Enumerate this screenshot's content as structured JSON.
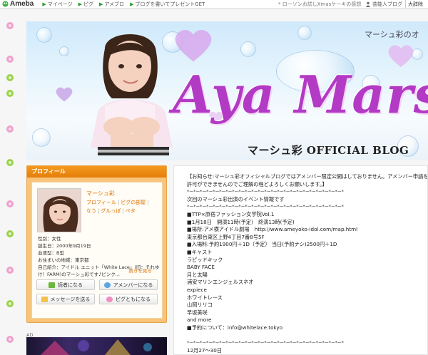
{
  "topbar": {
    "logo": "Ameba",
    "nav": [
      "マイページ",
      "ピグ",
      "アメブロ",
      "ブログを書いてプレゼントGET"
    ],
    "news": "* ローソンお試しXmasケーキの感想",
    "register": "芸能人ブログ",
    "lang": "大辞除"
  },
  "banner": {
    "subtitle": "マーシュ彩のオ",
    "title": "Aya Marsh",
    "blog_label": "マーシュ彩  OFFICIAL BLOG"
  },
  "profile": {
    "header": "プロフィール",
    "name": "マーシュ彩",
    "links": [
      "プロフィール",
      "ピグの部屋",
      "なう",
      "グルっぽ",
      "ペタ"
    ],
    "facts": [
      "性別：女性",
      "誕生日：2000年9月19日",
      "血液型：B型",
      "お住まいの地域：東京都",
      "自己紹介：アイドル ユニット「White Lace」(旧：それゆ",
      "け！FARM)のマーシュ彩です♪ピンク..."
    ],
    "more": "続きを見る",
    "buttons": {
      "reader": "読者になる",
      "member": "アメンバーになる",
      "message": "メッセージを送る",
      "pigg": "ピグともになる"
    }
  },
  "ad": {
    "label": "AD"
  },
  "article": {
    "lines": [
      "【お知らせ:マーシュ彩オフィシャルブログではアメンバー限定公開はしておりません。アメンバー申請を",
      "許可ができませんのでご理解の程どよろしくお願いします。】",
      "*−*−*−*−*−*−*−*−*−*−*−*−*−*−*−*−*−*−*−*−*−*−*−*−*",
      "次回のマーシュ彩出演のイベント情報です",
      "*−*−*−*−*−*−*−*−*−*−*−*−*−*−*−*−*−*−*−*−*−*−*−*−*",
      "■TTP×原宿ファッション女学院Vol.1",
      "■1月18日　開演11時(予定)　終演13時(予定)",
      "■場所:アメ横アイドル劇場　http://www.ameyoko-idol.com/map.html",
      "東京都台東区上野4丁目7番8号5F",
      "■入場料:予約1900円＋1D（予定） 当日(予約ナシ)2500円＋1D",
      "■キャスト",
      "ラピッドキック",
      "BABY FACE",
      "月と太陽",
      "浦安マリンエンジェルスネオ",
      "expiece",
      "ホワイトレース",
      "山岡リリコ",
      "早坂美咲",
      "and more",
      "■予約について：info@whitelace.tokyo",
      "",
      "*−*−*−*−*−*−*−*−*−*−*−*−*−*−*−*−*−*−*−*−*−*−*−*−*",
      "12月27〜30日"
    ]
  },
  "colors": {
    "accent_orange": "#e57d0a",
    "title_purple": "#b23ac4",
    "ameba_green": "#2e9b2e"
  }
}
